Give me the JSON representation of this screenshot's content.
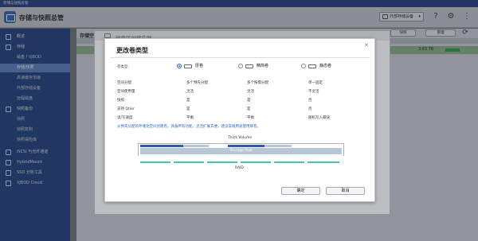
{
  "window": {
    "title": "存储与快照总管"
  },
  "header": {
    "app_title": "存储与快照总管",
    "external_dropdown": "外部存储设备",
    "icons": [
      "help-icon",
      "settings-icon",
      "more-icon"
    ]
  },
  "sidebar": {
    "items": [
      {
        "label": "概述",
        "icon": "overview-icon",
        "level": 0,
        "active": false
      },
      {
        "label": "存储",
        "icon": "storage-icon",
        "level": 0,
        "active": false
      },
      {
        "label": "磁盘 / VJBOD",
        "level": 1,
        "active": false
      },
      {
        "label": "存储/快照",
        "level": 1,
        "active": true
      },
      {
        "label": "高速缓存加速",
        "level": 1,
        "active": false
      },
      {
        "label": "外部存储设备",
        "level": 1,
        "active": false
      },
      {
        "label": "远程磁盘",
        "level": 1,
        "active": false
      },
      {
        "label": "快照备份",
        "icon": "snapshot-icon",
        "level": 0,
        "active": false
      },
      {
        "label": "快照",
        "level": 1,
        "active": false
      },
      {
        "label": "快照复制",
        "level": 1,
        "active": false
      },
      {
        "label": "快照保险库",
        "level": 1,
        "active": false
      },
      {
        "label": "iSCSI 与光纤通道",
        "icon": "iscsi-icon",
        "level": 0,
        "active": false
      },
      {
        "label": "HybridMount",
        "icon": "hybridmount-icon",
        "level": 0,
        "active": false
      },
      {
        "label": "SSD 分析工具",
        "icon": "ssd-icon",
        "level": 0,
        "active": false
      },
      {
        "label": "VJBOD Cloud",
        "icon": "cloud-icon",
        "level": 0,
        "active": false
      }
    ]
  },
  "background": {
    "title": "存储空",
    "buttons": [
      "快照",
      "管理"
    ],
    "value": "3.63 TB"
  },
  "wizard": {
    "title": "磁盘区创建向导"
  },
  "dialog": {
    "title": "更改卷类型",
    "volume_type_label": "卷类型：",
    "options": [
      {
        "label": "厚卷",
        "checked": true
      },
      {
        "label": "精简卷",
        "checked": false
      },
      {
        "label": "静态卷",
        "checked": false
      }
    ],
    "features": [
      [
        "空间分配",
        "多个预先分配",
        "多个按需分配",
        "单一固定"
      ],
      [
        "空间使用量",
        "灵活",
        "灵活",
        "不灵活"
      ],
      [
        "快照",
        "是",
        "是",
        "否"
      ],
      [
        "支持 Qtier",
        "是",
        "是",
        "否"
      ],
      [
        "读/写速度",
        "平衡",
        "平衡",
        "随机写入最快"
      ]
    ],
    "note": "从预先分配的存储池空间创建卷。具备所有功能，灵活扩展方便，建议常规用途使用厚卷。",
    "diagram": {
      "thick_label": "Thick Volume",
      "pool_label": "Storage Pool",
      "raid_label": "RAID"
    },
    "buttons": {
      "ok": "确定",
      "cancel": "取消"
    }
  }
}
